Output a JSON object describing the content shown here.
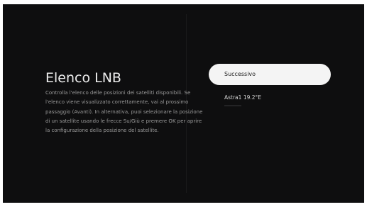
{
  "screen": {
    "title": "Elenco LNB",
    "description": "Controlla l'elenco delle posizioni dei satelliti disponibili. Se l'elenco viene visualizzato correttamente, vai al prossimo passaggio (Avanti). In alternativa, puoi selezionare la posizione di un satellite usando le frecce Su/Giù e premere OK per aprire la configurazione della posizione del satellite."
  },
  "actions": {
    "next_label": "Successivo"
  },
  "satellites": [
    {
      "label": "Astra1 19.2°E"
    }
  ],
  "colors": {
    "background": "#0e0e0f",
    "button": "#f4f4f4",
    "title_text": "#ededed",
    "body_text": "#9a9a9a"
  }
}
